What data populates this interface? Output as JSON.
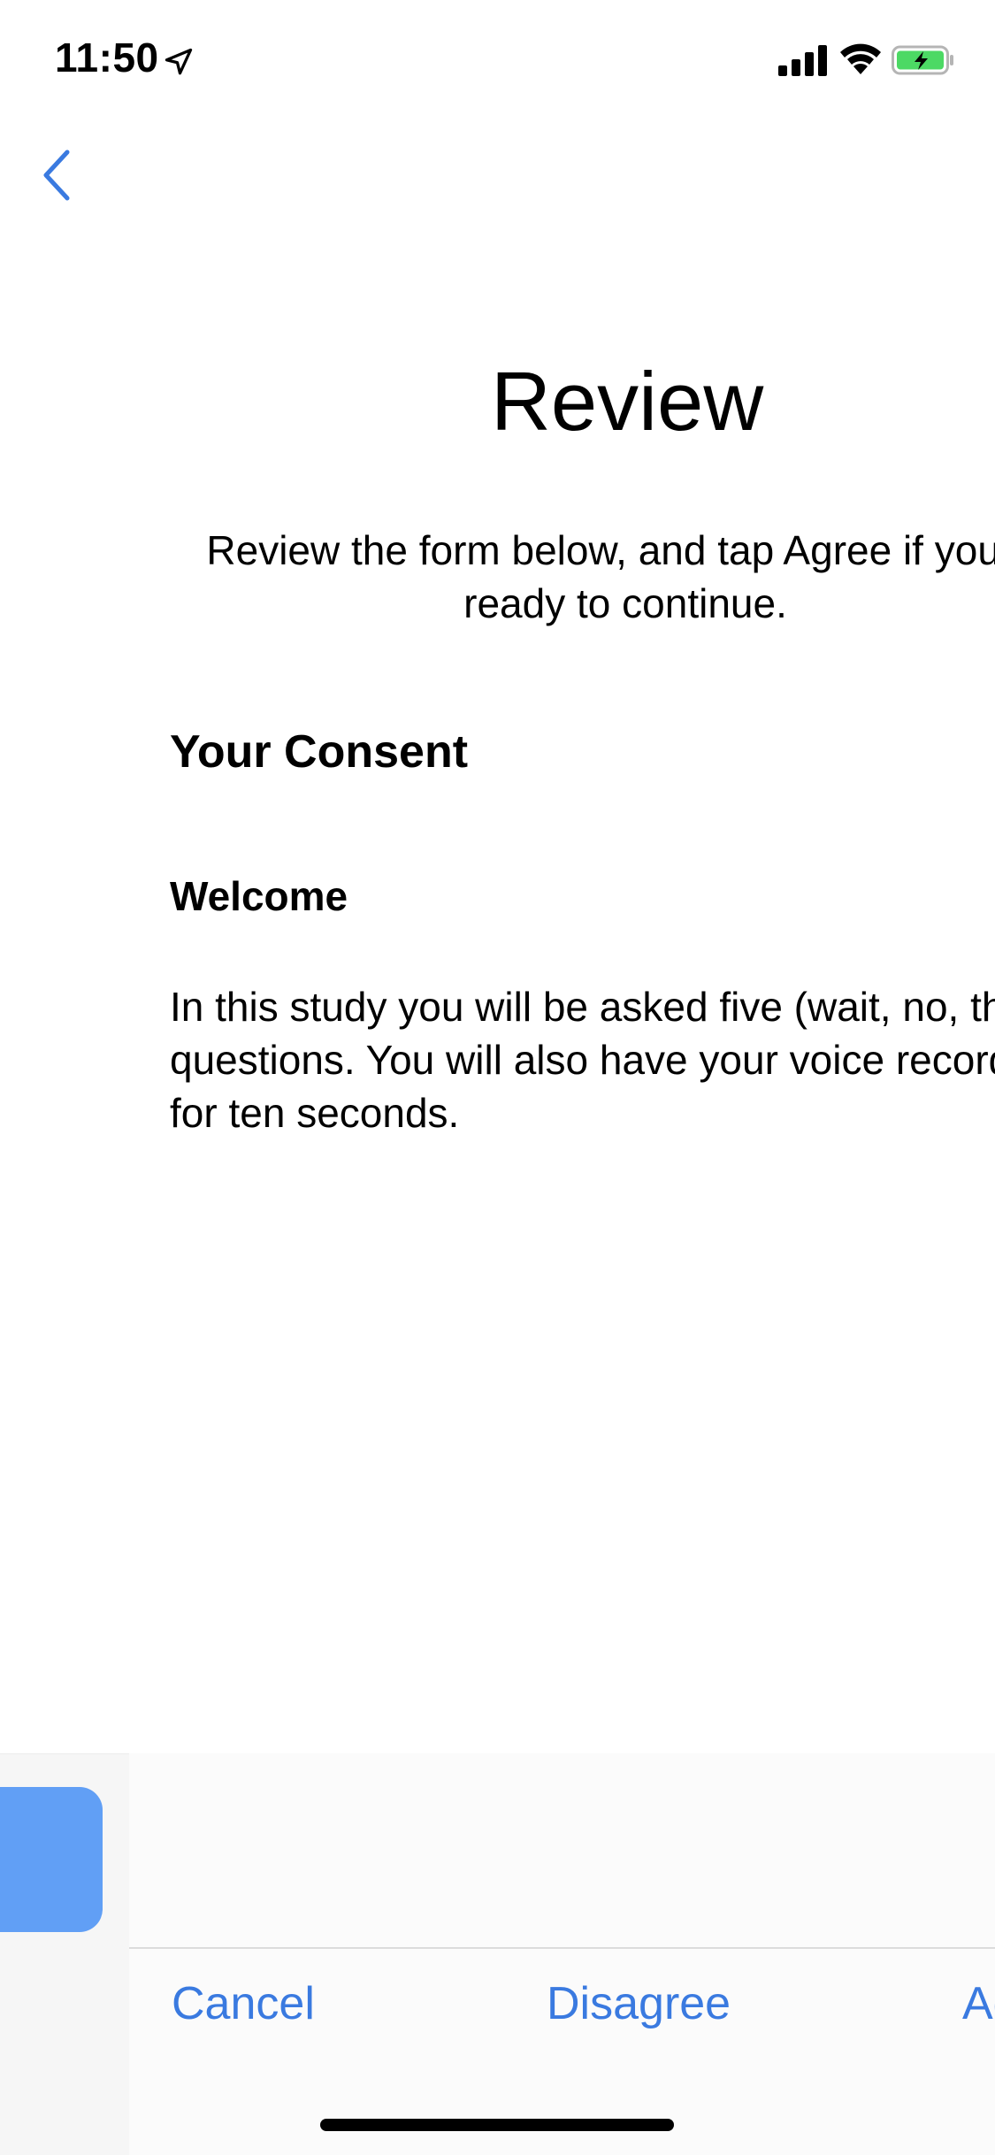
{
  "status_bar": {
    "time": "11:50",
    "icons": [
      "location-arrow-icon",
      "cellular-signal-icon",
      "wifi-icon",
      "battery-charging-icon"
    ],
    "battery_color": "#4cd964"
  },
  "nav": {
    "back_icon": "chevron-left-icon",
    "accent_color": "#3a7ae0"
  },
  "main": {
    "title": "Review",
    "subtitle": "Review the form below, and tap Agree if you're ready to continue.",
    "section_title": "Your Consent",
    "subsection_title": "Welcome",
    "body": "In this study you will be asked five (wait, no, three!) questions. You will also have your voice recorded for ten seconds."
  },
  "toolbar": {
    "cancel_label": "Cancel",
    "disagree_label": "Disagree",
    "agree_label": "Agree"
  }
}
